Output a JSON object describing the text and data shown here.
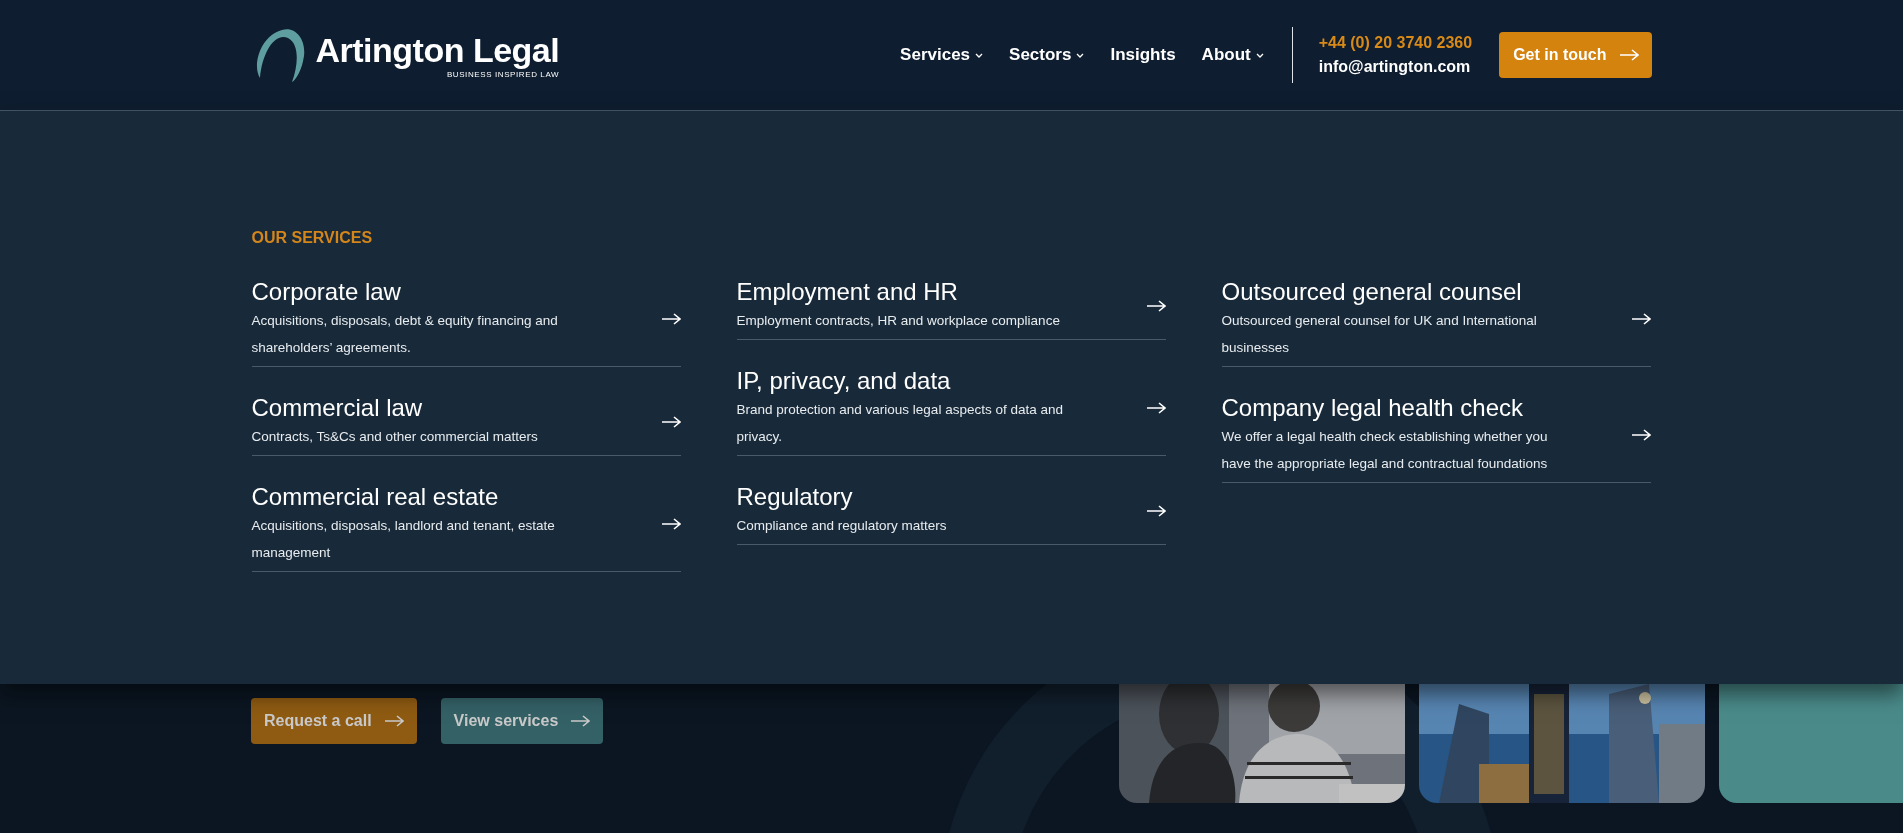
{
  "header": {
    "logo": {
      "name": "Artington Legal",
      "tagline": "BUSINESS INSPIRED LAW"
    },
    "nav": [
      {
        "label": "Services",
        "has_dropdown": true
      },
      {
        "label": "Sectors",
        "has_dropdown": true
      },
      {
        "label": "Insights",
        "has_dropdown": false
      },
      {
        "label": "About",
        "has_dropdown": true
      }
    ],
    "phone": "+44 (0) 20 3740 2360",
    "email": "info@artington.com",
    "cta": "Get in touch"
  },
  "menu": {
    "heading": "OUR SERVICES",
    "columns": [
      [
        {
          "title": "Corporate law",
          "description": "Acquisitions, disposals, debt & equity financing and shareholders’ agreements."
        },
        {
          "title": "Commercial law",
          "description": "Contracts, Ts&Cs and other commercial matters"
        },
        {
          "title": "Commercial real estate",
          "description": "Acquisitions, disposals, landlord and tenant, estate management"
        }
      ],
      [
        {
          "title": "Employment and HR",
          "description": "Employment contracts, HR and workplace compliance"
        },
        {
          "title": "IP, privacy, and data",
          "description": "Brand protection and various legal aspects of data and privacy."
        },
        {
          "title": "Regulatory",
          "description": "Compliance and regulatory matters"
        }
      ],
      [
        {
          "title": "Outsourced general counsel",
          "description": "Outsourced general counsel for UK and International businesses"
        },
        {
          "title": "Company legal health check",
          "description": "We offer a legal health check establishing whether you have the appropriate legal and contractual foundations"
        }
      ]
    ]
  },
  "hero": {
    "buttons": [
      {
        "label": "Request a call",
        "kind": "primary"
      },
      {
        "label": "View services",
        "kind": "secondary"
      }
    ],
    "cards": [
      {
        "kind": "people"
      },
      {
        "kind": "city"
      },
      {
        "kind": "plain"
      }
    ]
  }
}
